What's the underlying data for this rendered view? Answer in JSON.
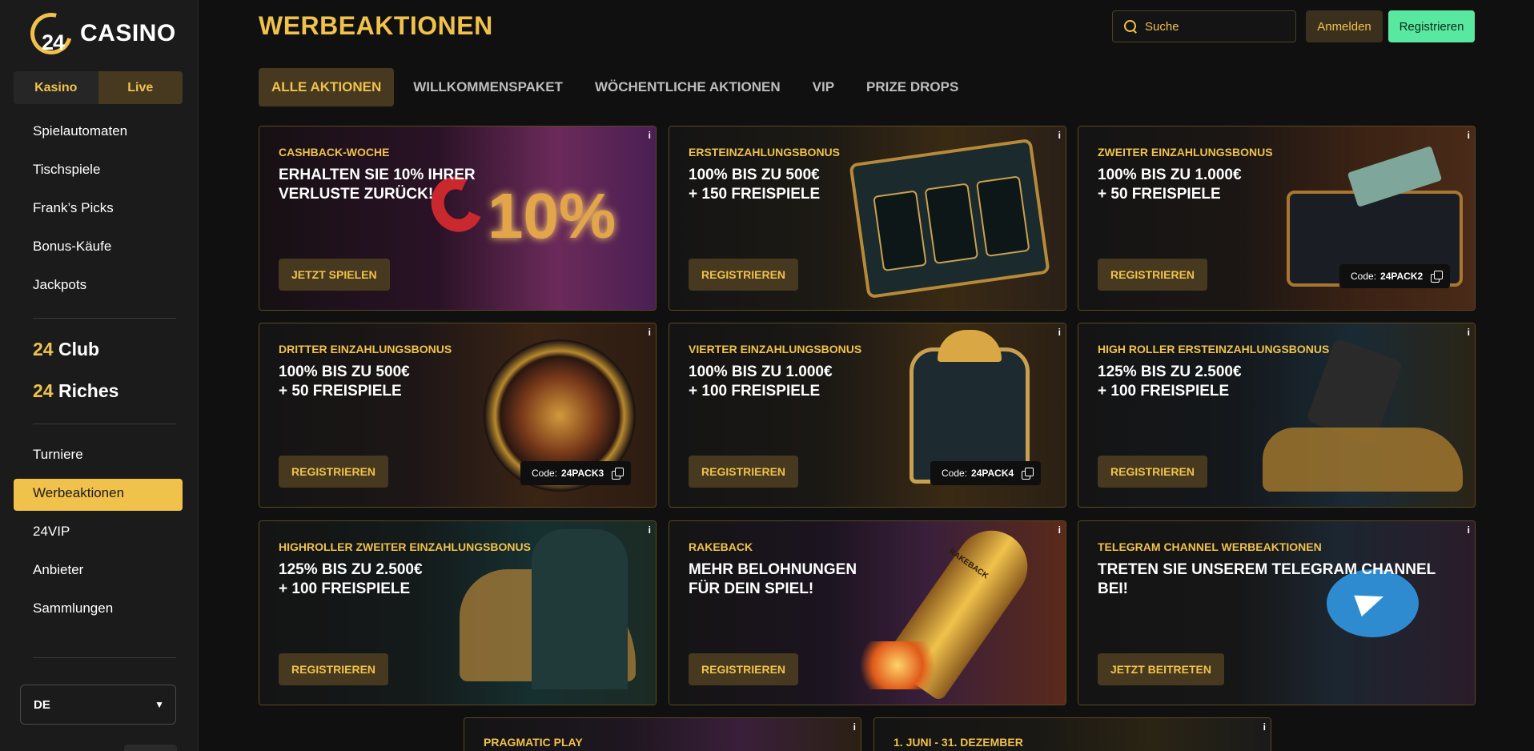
{
  "brand": {
    "num": "24",
    "word": "CASINO"
  },
  "mode": {
    "kasino": "Kasino",
    "live": "Live"
  },
  "nav": {
    "group1": [
      "Spielautomaten",
      "Tischspiele",
      "Frank’s Picks",
      "Bonus-Käufe",
      "Jackpots"
    ],
    "club": {
      "num": "24",
      "word": "Club"
    },
    "riches": {
      "num": "24",
      "word": "Riches"
    },
    "group2": [
      "Turniere",
      "Werbeaktionen",
      "24VIP",
      "Anbieter",
      "Sammlungen"
    ]
  },
  "language": "DE",
  "header": {
    "title": "WERBEAKTIONEN",
    "search_placeholder": "Suche",
    "login": "Anmelden",
    "register": "Registrieren"
  },
  "tabs": [
    "ALLE AKTIONEN",
    "WILLKOMMENSPAKET",
    "WÖCHENTLICHE AKTIONEN",
    "VIP",
    "PRIZE DROPS"
  ],
  "promos": [
    {
      "label": "CASHBACK-WOCHE",
      "headline": "ERHALTEN SIE 10% IHRER\nVERLUSTE ZURÜCK!",
      "cta": "JETZT SPIELEN",
      "art_text": "10%"
    },
    {
      "label": "ERSTEINZAHLUNGSBONUS",
      "headline": "100% BIS ZU 500€\n+ 150 FREISPIELE",
      "cta": "REGISTRIEREN"
    },
    {
      "label": "ZWEITER EINZAHLUNGSBONUS",
      "headline": "100% BIS ZU 1.000€\n+ 50 FREISPIELE",
      "cta": "REGISTRIEREN",
      "code_label": "Code:",
      "code": "24PACK2"
    },
    {
      "label": "DRITTER EINZAHLUNGSBONUS",
      "headline": "100% BIS ZU 500€\n+ 50 FREISPIELE",
      "cta": "REGISTRIEREN",
      "code_label": "Code:",
      "code": "24PACK3"
    },
    {
      "label": "VIERTER EINZAHLUNGSBONUS",
      "headline": "100% BIS ZU 1.000€\n+ 100 FREISPIELE",
      "cta": "REGISTRIEREN",
      "code_label": "Code:",
      "code": "24PACK4"
    },
    {
      "label": "HIGH ROLLER ERSTEINZAHLUNGSBONUS",
      "headline": "125% BIS ZU 2.500€\n+ 100 FREISPIELE",
      "cta": "REGISTRIEREN"
    },
    {
      "label": "HIGHROLLER ZWEITER EINZAHLUNGSBONUS",
      "headline": "125% BIS ZU 2.500€\n+ 100 FREISPIELE",
      "cta": "REGISTRIEREN"
    },
    {
      "label": "RAKEBACK",
      "headline": "MEHR BELOHNUNGEN\nFÜR DEIN SPIEL!",
      "cta": "REGISTRIEREN",
      "art_text": "RAKEBACK"
    },
    {
      "label": "TELEGRAM CHANNEL WERBEAKTIONEN",
      "headline": "TRETEN SIE UNSEREM TELEGRAM CHANNEL BEI!",
      "cta": "JETZT BEITRETEN"
    },
    {
      "label": "PRAGMATIC PLAY"
    },
    {
      "label": "1. JUNI - 31. DEZEMBER"
    }
  ],
  "info_glyph": "i",
  "colors": {
    "accent": "#f0c24b",
    "register": "#59e8a0",
    "bg": "#101010",
    "sidebar": "#1b1b1b"
  }
}
